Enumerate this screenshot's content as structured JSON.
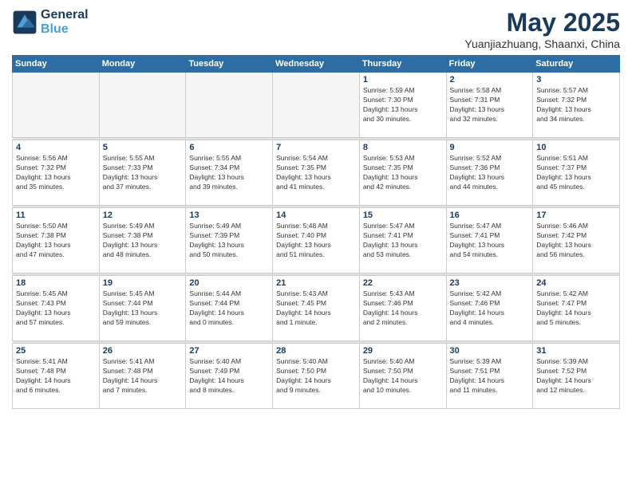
{
  "logo": {
    "line1": "General",
    "line2": "Blue"
  },
  "header": {
    "month": "May 2025",
    "location": "Yuanjiazhuang, Shaanxi, China"
  },
  "weekdays": [
    "Sunday",
    "Monday",
    "Tuesday",
    "Wednesday",
    "Thursday",
    "Friday",
    "Saturday"
  ],
  "weeks": [
    [
      {
        "day": "",
        "info": ""
      },
      {
        "day": "",
        "info": ""
      },
      {
        "day": "",
        "info": ""
      },
      {
        "day": "",
        "info": ""
      },
      {
        "day": "1",
        "info": "Sunrise: 5:59 AM\nSunset: 7:30 PM\nDaylight: 13 hours\nand 30 minutes."
      },
      {
        "day": "2",
        "info": "Sunrise: 5:58 AM\nSunset: 7:31 PM\nDaylight: 13 hours\nand 32 minutes."
      },
      {
        "day": "3",
        "info": "Sunrise: 5:57 AM\nSunset: 7:32 PM\nDaylight: 13 hours\nand 34 minutes."
      }
    ],
    [
      {
        "day": "4",
        "info": "Sunrise: 5:56 AM\nSunset: 7:32 PM\nDaylight: 13 hours\nand 35 minutes."
      },
      {
        "day": "5",
        "info": "Sunrise: 5:55 AM\nSunset: 7:33 PM\nDaylight: 13 hours\nand 37 minutes."
      },
      {
        "day": "6",
        "info": "Sunrise: 5:55 AM\nSunset: 7:34 PM\nDaylight: 13 hours\nand 39 minutes."
      },
      {
        "day": "7",
        "info": "Sunrise: 5:54 AM\nSunset: 7:35 PM\nDaylight: 13 hours\nand 41 minutes."
      },
      {
        "day": "8",
        "info": "Sunrise: 5:53 AM\nSunset: 7:35 PM\nDaylight: 13 hours\nand 42 minutes."
      },
      {
        "day": "9",
        "info": "Sunrise: 5:52 AM\nSunset: 7:36 PM\nDaylight: 13 hours\nand 44 minutes."
      },
      {
        "day": "10",
        "info": "Sunrise: 5:51 AM\nSunset: 7:37 PM\nDaylight: 13 hours\nand 45 minutes."
      }
    ],
    [
      {
        "day": "11",
        "info": "Sunrise: 5:50 AM\nSunset: 7:38 PM\nDaylight: 13 hours\nand 47 minutes."
      },
      {
        "day": "12",
        "info": "Sunrise: 5:49 AM\nSunset: 7:38 PM\nDaylight: 13 hours\nand 48 minutes."
      },
      {
        "day": "13",
        "info": "Sunrise: 5:49 AM\nSunset: 7:39 PM\nDaylight: 13 hours\nand 50 minutes."
      },
      {
        "day": "14",
        "info": "Sunrise: 5:48 AM\nSunset: 7:40 PM\nDaylight: 13 hours\nand 51 minutes."
      },
      {
        "day": "15",
        "info": "Sunrise: 5:47 AM\nSunset: 7:41 PM\nDaylight: 13 hours\nand 53 minutes."
      },
      {
        "day": "16",
        "info": "Sunrise: 5:47 AM\nSunset: 7:41 PM\nDaylight: 13 hours\nand 54 minutes."
      },
      {
        "day": "17",
        "info": "Sunrise: 5:46 AM\nSunset: 7:42 PM\nDaylight: 13 hours\nand 56 minutes."
      }
    ],
    [
      {
        "day": "18",
        "info": "Sunrise: 5:45 AM\nSunset: 7:43 PM\nDaylight: 13 hours\nand 57 minutes."
      },
      {
        "day": "19",
        "info": "Sunrise: 5:45 AM\nSunset: 7:44 PM\nDaylight: 13 hours\nand 59 minutes."
      },
      {
        "day": "20",
        "info": "Sunrise: 5:44 AM\nSunset: 7:44 PM\nDaylight: 14 hours\nand 0 minutes."
      },
      {
        "day": "21",
        "info": "Sunrise: 5:43 AM\nSunset: 7:45 PM\nDaylight: 14 hours\nand 1 minute."
      },
      {
        "day": "22",
        "info": "Sunrise: 5:43 AM\nSunset: 7:46 PM\nDaylight: 14 hours\nand 2 minutes."
      },
      {
        "day": "23",
        "info": "Sunrise: 5:42 AM\nSunset: 7:46 PM\nDaylight: 14 hours\nand 4 minutes."
      },
      {
        "day": "24",
        "info": "Sunrise: 5:42 AM\nSunset: 7:47 PM\nDaylight: 14 hours\nand 5 minutes."
      }
    ],
    [
      {
        "day": "25",
        "info": "Sunrise: 5:41 AM\nSunset: 7:48 PM\nDaylight: 14 hours\nand 6 minutes."
      },
      {
        "day": "26",
        "info": "Sunrise: 5:41 AM\nSunset: 7:48 PM\nDaylight: 14 hours\nand 7 minutes."
      },
      {
        "day": "27",
        "info": "Sunrise: 5:40 AM\nSunset: 7:49 PM\nDaylight: 14 hours\nand 8 minutes."
      },
      {
        "day": "28",
        "info": "Sunrise: 5:40 AM\nSunset: 7:50 PM\nDaylight: 14 hours\nand 9 minutes."
      },
      {
        "day": "29",
        "info": "Sunrise: 5:40 AM\nSunset: 7:50 PM\nDaylight: 14 hours\nand 10 minutes."
      },
      {
        "day": "30",
        "info": "Sunrise: 5:39 AM\nSunset: 7:51 PM\nDaylight: 14 hours\nand 11 minutes."
      },
      {
        "day": "31",
        "info": "Sunrise: 5:39 AM\nSunset: 7:52 PM\nDaylight: 14 hours\nand 12 minutes."
      }
    ]
  ]
}
